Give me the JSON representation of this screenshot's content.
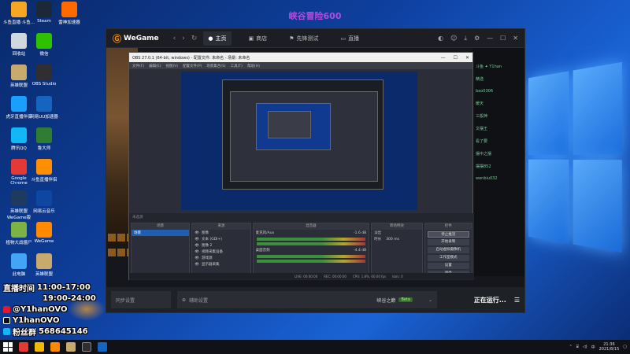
{
  "stream_title": "峡谷冒险600",
  "desktop": {
    "icons": [
      {
        "label": "斗鱼直播·斗鱼...",
        "color": "#f5a623"
      },
      {
        "label": "Steam",
        "color": "#1b2838"
      },
      {
        "label": "雷神加速器",
        "color": "#ff6a00"
      },
      {
        "label": "回收站",
        "color": "#cfd8dc"
      },
      {
        "label": "微信",
        "color": "#2dc100"
      },
      {
        "label": "英雄联盟",
        "color": "#c8aa6e"
      },
      {
        "label": "OBS Studio",
        "color": "#302e31"
      },
      {
        "label": "虎牙直播伴侣",
        "color": "#1a9fff"
      },
      {
        "label": "网易UU加速器",
        "color": "#1565c0"
      },
      {
        "label": "腾讯QQ",
        "color": "#12b7f5"
      },
      {
        "label": "鲁大师",
        "color": "#2e7d32"
      },
      {
        "label": "Google Chrome",
        "color": "#e53935"
      },
      {
        "label": "斗鱼直播伴侣",
        "color": "#ff8f00"
      },
      {
        "label": "英雄联盟WeGame版",
        "color": "#1e3a5f"
      },
      {
        "label": "网易云音乐",
        "color": "#0d47a1"
      },
      {
        "label": "植物大战僵尸",
        "color": "#7cb342"
      },
      {
        "label": "WeGame",
        "color": "#ff8a00"
      },
      {
        "label": "此电脑",
        "color": "#42a5f5"
      },
      {
        "label": "英雄联盟",
        "color": "#c8aa6e"
      }
    ]
  },
  "wegame": {
    "logo": "WeGame",
    "tabs": {
      "home": "主页",
      "store": "商店",
      "pioneer": "先锋测试",
      "live": "直播"
    },
    "chat_lines": [
      "斗鱼 ✦ Y1han",
      "精选",
      "bao0306",
      "暖天",
      "三般神",
      "文摆王",
      "看了要",
      "摆中之摆",
      "摆摆852",
      "wenbiu032"
    ],
    "bottom": {
      "left_box": "同步设置",
      "assist": "辅助设置",
      "game": "峡谷之巅",
      "beta": "Beta",
      "running": "正在运行..."
    }
  },
  "obs": {
    "title": "OBS 27.0.1 (64-bit, windows) - 配置文件: 未命名 - 场景: 未命名",
    "menu": [
      "文件(F)",
      "编辑(E)",
      "视图(V)",
      "配置文件(P)",
      "场景集合(S)",
      "工具(T)",
      "帮助(H)"
    ],
    "win_controls": [
      "—",
      "☐",
      "✕"
    ],
    "preview_status": "未选源",
    "docks": {
      "scenes": {
        "title": "场景",
        "items": [
          "场景"
        ]
      },
      "sources": {
        "title": "来源",
        "items": [
          "图像",
          "文本 (GDI+)",
          "图像 2",
          "视频采集设备",
          "游戏源",
          "显示器采集"
        ]
      },
      "mixer": {
        "title": "混音器",
        "tracks": [
          {
            "name": "麦克风/Aux",
            "level": "-1.6 dB"
          },
          {
            "name": "桌面音频",
            "level": "-4.4 dB"
          }
        ]
      },
      "transitions": {
        "title": "转场特效",
        "type": "淡出",
        "duration_label": "时长",
        "duration": "300 ms"
      },
      "controls": {
        "title": "控件",
        "buttons": [
          "停止推流",
          "开始录制",
          "启动虚拟摄像机",
          "工作室模式",
          "设置",
          "退出"
        ]
      }
    },
    "statusbar": {
      "live": "LIVE: 00:00:00",
      "rec": "REC: 00:00:00",
      "cpu": "CPU: 1.8%, 60.00 fps",
      "kb": "kb/s: 0"
    }
  },
  "overlay": {
    "schedule_label": "直播时间",
    "time1": "11:00-17:00",
    "time2": "19:00-24:00",
    "weibo": "@Y1hanOVO",
    "douyin": "Y1hanOVO",
    "fans_label": "粉丝群",
    "fans_group": "568645146"
  },
  "taskbar": {
    "time": "21:36",
    "date": "2021/8/15",
    "lang": "中"
  }
}
